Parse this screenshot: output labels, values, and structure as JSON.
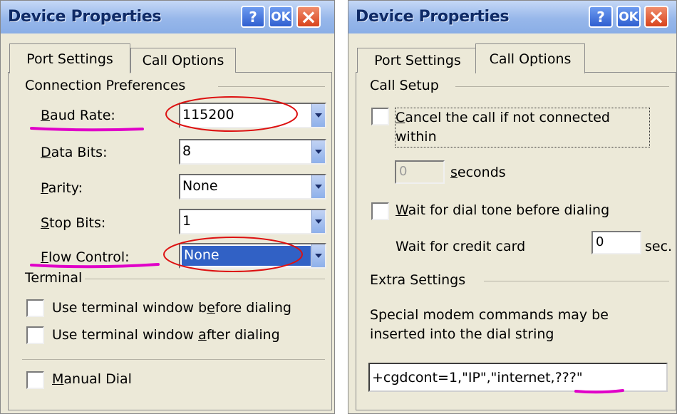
{
  "left": {
    "title": "Device Properties",
    "help_label": "?",
    "ok_label": "OK",
    "close_label": "×",
    "tabs": [
      {
        "label": "Port Settings"
      },
      {
        "label": "Call Options"
      }
    ],
    "conn_group": "Connection Preferences",
    "baud": {
      "label": "Baud Rate:",
      "key": "B",
      "rest": "aud Rate:",
      "value": "115200"
    },
    "databits": {
      "key": "D",
      "rest": "ata Bits:",
      "value": "8"
    },
    "parity": {
      "key": "P",
      "rest": "arity:",
      "value": "None"
    },
    "stopbits": {
      "key": "S",
      "rest": "top Bits:",
      "value": "1"
    },
    "flow": {
      "key": "F",
      "rest": "low Control:",
      "value": "None"
    },
    "terminal_group": "Terminal",
    "before": {
      "pre": "Use terminal window b",
      "key": "e",
      "post": "fore dialing"
    },
    "after": {
      "pre": "Use terminal window ",
      "key": "a",
      "post": "fter dialing"
    },
    "manual": {
      "key": "M",
      "rest": "anual Dial"
    }
  },
  "right": {
    "title": "Device Properties",
    "help_label": "?",
    "ok_label": "OK",
    "close_label": "×",
    "tabs": [
      {
        "label": "Port Settings"
      },
      {
        "label": "Call Options"
      }
    ],
    "setup_group": "Call Setup",
    "cancel": {
      "key": "C",
      "line1": "ancel the call if not connected",
      "line2": "within"
    },
    "seconds_value": "0",
    "seconds": {
      "key": "s",
      "rest": "econds"
    },
    "wait_dial": {
      "key": "W",
      "rest": "ait for dial tone before dialing"
    },
    "credit_label": "Wait for credit card",
    "credit_value": "0",
    "sec_label": "sec.",
    "extra_group": "Extra Settings",
    "special_line1": "Special modem commands may be",
    "special_line2": "inserted into the dial string",
    "dial_string": "+cgdcont=1,\"IP\",\"internet,???\""
  },
  "colors": {
    "annotation_red": "#dd1111",
    "annotation_magenta": "#e000c8",
    "selection": "#3161c5"
  }
}
